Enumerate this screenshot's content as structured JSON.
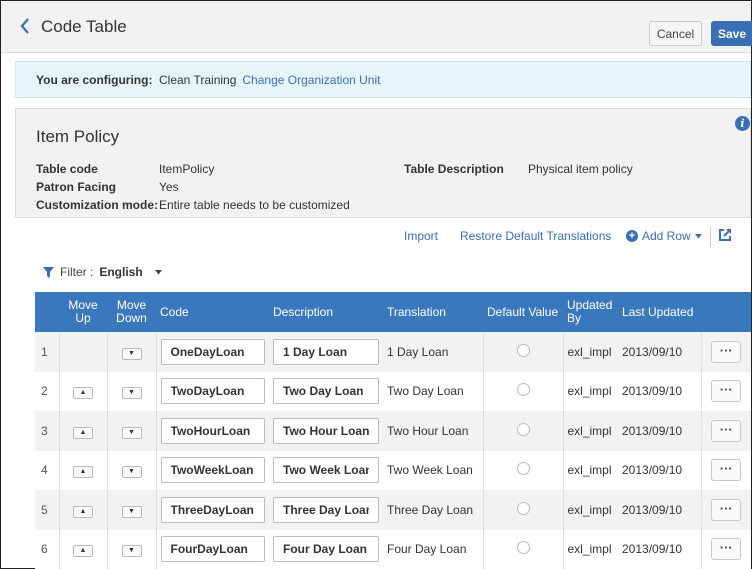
{
  "header": {
    "title": "Code Table",
    "cancel_label": "Cancel",
    "save_label": "Save"
  },
  "config": {
    "label": "You are configuring:",
    "value": "Clean Training",
    "link": "Change Organization Unit"
  },
  "policy": {
    "title": "Item Policy",
    "table_code_label": "Table code",
    "table_code_value": "ItemPolicy",
    "patron_facing_label": "Patron Facing",
    "patron_facing_value": "Yes",
    "customization_label": "Customization mode:",
    "customization_value": "Entire table needs to be customized",
    "table_desc_label": "Table Description",
    "table_desc_value": "Physical item policy"
  },
  "toolbar": {
    "import": "Import",
    "restore": "Restore Default Translations",
    "add_row": "Add Row"
  },
  "filter": {
    "label": "Filter :",
    "value": "English"
  },
  "table": {
    "columns": {
      "move_up": "Move Up",
      "move_down": "Move Down",
      "code": "Code",
      "description": "Description",
      "translation": "Translation",
      "default_value": "Default Value",
      "updated_by": "Updated By",
      "last_updated": "Last Updated"
    },
    "rows": [
      {
        "num": "1",
        "code": "OneDayLoan",
        "description": "1 Day Loan",
        "translation": "1 Day Loan",
        "updated_by": "exl_impl",
        "last_updated": "2013/09/10"
      },
      {
        "num": "2",
        "code": "TwoDayLoan",
        "description": "Two Day Loan",
        "translation": "Two Day Loan",
        "updated_by": "exl_impl",
        "last_updated": "2013/09/10"
      },
      {
        "num": "3",
        "code": "TwoHourLoan",
        "description": "Two Hour Loan",
        "translation": "Two Hour Loan",
        "updated_by": "exl_impl",
        "last_updated": "2013/09/10"
      },
      {
        "num": "4",
        "code": "TwoWeekLoan",
        "description": "Two Week Loan",
        "translation": "Two Week Loan",
        "updated_by": "exl_impl",
        "last_updated": "2013/09/10"
      },
      {
        "num": "5",
        "code": "ThreeDayLoan",
        "description": "Three Day Loan",
        "translation": "Three Day Loan",
        "updated_by": "exl_impl",
        "last_updated": "2013/09/10"
      },
      {
        "num": "6",
        "code": "FourDayLoan",
        "description": "Four Day Loan",
        "translation": "Four Day Loan",
        "updated_by": "exl_impl",
        "last_updated": "2013/09/10"
      }
    ]
  }
}
